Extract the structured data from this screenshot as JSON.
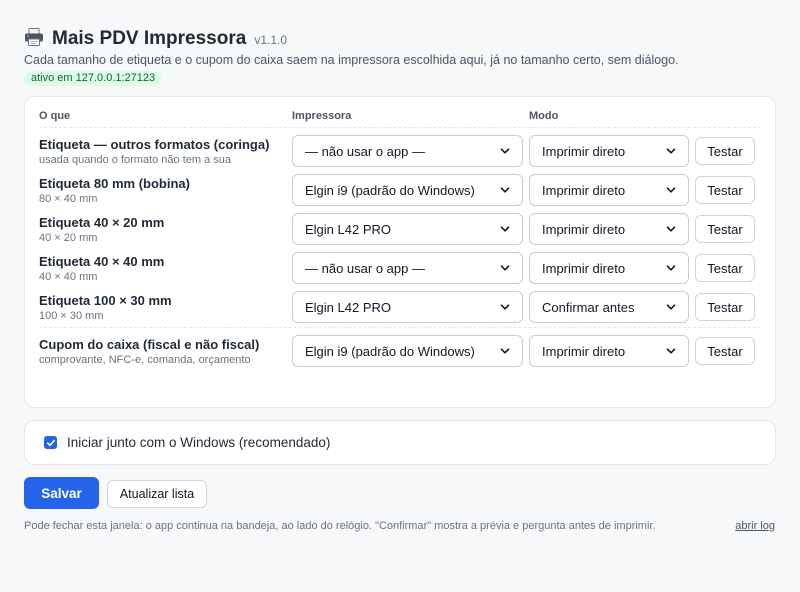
{
  "header": {
    "title": "Mais PDV Impressora",
    "version": "v1.1.0",
    "subtitle": "Cada tamanho de etiqueta e o cupom do caixa saem na impressora escolhida aqui, já no tamanho certo, sem diálogo.",
    "status": "ativo em 127.0.0.1:27123",
    "icon": "printer-icon"
  },
  "table": {
    "columns": {
      "what": "O que",
      "printer": "Impressora",
      "mode": "Modo"
    },
    "rows": [
      {
        "name": "Etiqueta — outros formatos (coringa)",
        "desc": "usada quando o formato não tem a sua",
        "printer": "— não usar o app —",
        "mode": "Imprimir direto",
        "test": "Testar"
      },
      {
        "name": "Etiqueta 80 mm (bobina)",
        "desc": "80 × 40 mm",
        "printer": "Elgin i9 (padrão do Windows)",
        "mode": "Imprimir direto",
        "test": "Testar"
      },
      {
        "name": "Etiqueta 40 × 20 mm",
        "desc": "40 × 20 mm",
        "printer": "Elgin L42 PRO",
        "mode": "Imprimir direto",
        "test": "Testar"
      },
      {
        "name": "Etiqueta 40 × 40 mm",
        "desc": "40 × 40 mm",
        "printer": "— não usar o app —",
        "mode": "Imprimir direto",
        "test": "Testar"
      },
      {
        "name": "Etiqueta 100 × 30 mm",
        "desc": "100 × 30 mm",
        "printer": "Elgin L42 PRO",
        "mode": "Confirmar antes",
        "test": "Testar"
      },
      {
        "name": "Cupom do caixa (fiscal e não fiscal)",
        "desc": "comprovante, NFC-e, comanda, orçamento",
        "printer": "Elgin i9 (padrão do Windows)",
        "mode": "Imprimir direto",
        "test": "Testar"
      }
    ]
  },
  "startup": {
    "label": "Iniciar junto com o Windows (recomendado)",
    "checked": true
  },
  "actions": {
    "save": "Salvar",
    "refresh": "Atualizar lista"
  },
  "footer": {
    "note": "Pode fechar esta janela: o app continua na bandeja, ao lado do relógio. \"Confirmar\" mostra a prévia e pergunta antes de imprimir.",
    "log_link": "abrir log"
  },
  "colors": {
    "accent": "#2563eb",
    "status_bg": "#dcfce7",
    "status_text": "#166534"
  }
}
